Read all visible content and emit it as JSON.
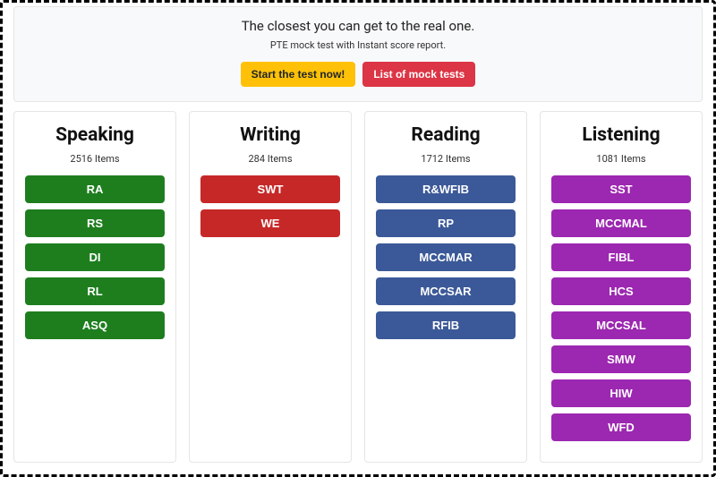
{
  "hero": {
    "title": "The closest you can get to the real one.",
    "subtitle": "PTE mock test with Instant score report.",
    "start_label": "Start the test now!",
    "list_label": "List of mock tests"
  },
  "columns": [
    {
      "title": "Speaking",
      "count_text": "2516 Items",
      "color": "green",
      "items": [
        "RA",
        "RS",
        "DI",
        "RL",
        "ASQ"
      ]
    },
    {
      "title": "Writing",
      "count_text": "284 Items",
      "color": "red",
      "items": [
        "SWT",
        "WE"
      ]
    },
    {
      "title": "Reading",
      "count_text": "1712 Items",
      "color": "blue",
      "items": [
        "R&WFIB",
        "RP",
        "MCCMAR",
        "MCCSAR",
        "RFIB"
      ]
    },
    {
      "title": "Listening",
      "count_text": "1081 Items",
      "color": "purple",
      "items": [
        "SST",
        "MCCMAL",
        "FIBL",
        "HCS",
        "MCCSAL",
        "SMW",
        "HIW",
        "WFD"
      ]
    }
  ]
}
